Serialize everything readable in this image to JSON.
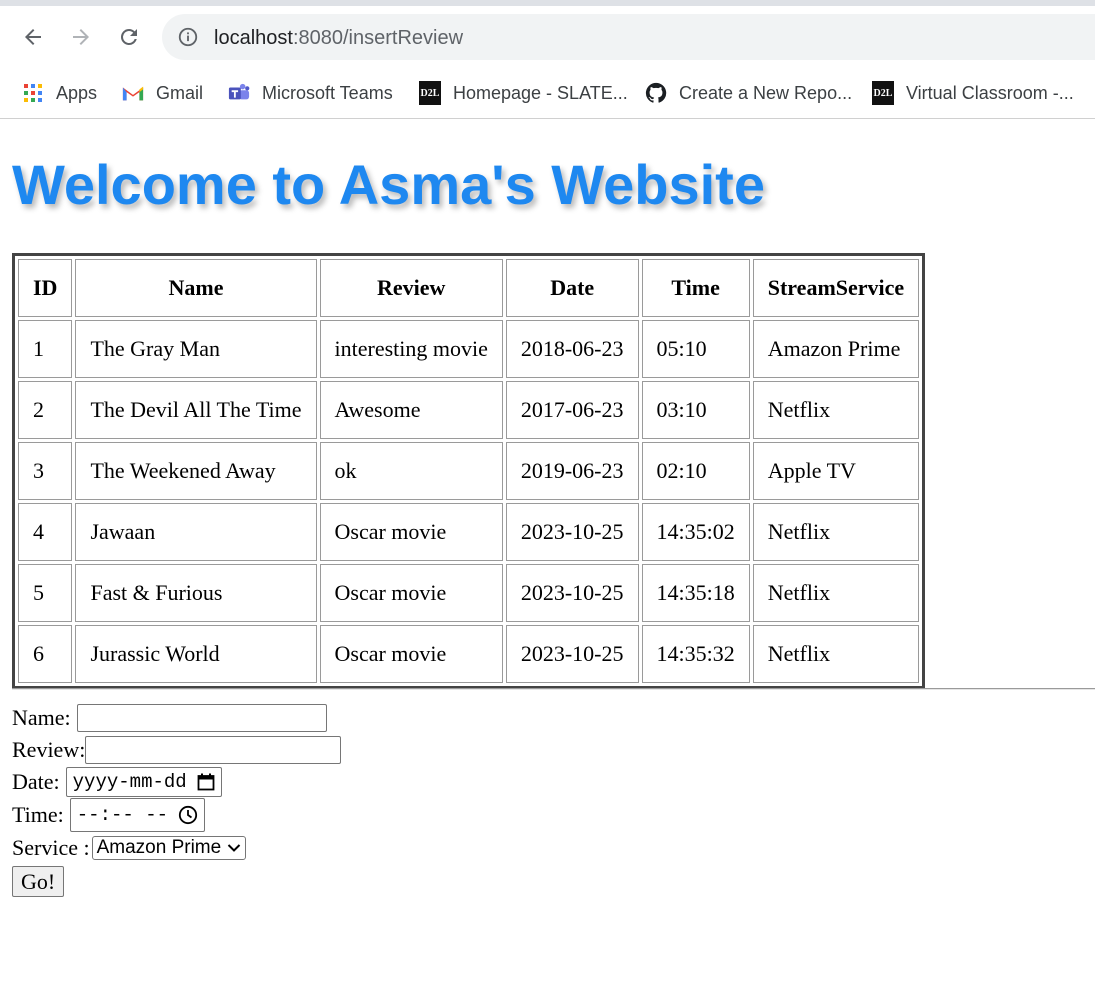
{
  "browser": {
    "url_host": "localhost",
    "url_path": ":8080/insertReview",
    "bookmarks": [
      {
        "label": "Apps",
        "icon": "apps-grid-icon"
      },
      {
        "label": "Gmail",
        "icon": "gmail-icon"
      },
      {
        "label": "Microsoft Teams",
        "icon": "teams-icon"
      },
      {
        "label": "Homepage - SLATE...",
        "icon": "d2l-icon",
        "icon_text": "D2L"
      },
      {
        "label": "Create a New Repo...",
        "icon": "github-icon"
      },
      {
        "label": "Virtual Classroom -...",
        "icon": "d2l-icon",
        "icon_text": "D2L"
      }
    ]
  },
  "page": {
    "title": "Welcome to Asma's Website",
    "title_color": "#1e88f0",
    "table": {
      "headers": [
        "ID",
        "Name",
        "Review",
        "Date",
        "Time",
        "StreamService"
      ],
      "rows": [
        [
          "1",
          "The Gray Man",
          "interesting movie",
          "2018-06-23",
          "05:10",
          "Amazon Prime"
        ],
        [
          "2",
          "The Devil All The Time",
          "Awesome",
          "2017-06-23",
          "03:10",
          "Netflix"
        ],
        [
          "3",
          "The Weekened Away",
          "ok",
          "2019-06-23",
          "02:10",
          "Apple TV"
        ],
        [
          "4",
          "Jawaan",
          "Oscar movie",
          "2023-10-25",
          "14:35:02",
          "Netflix"
        ],
        [
          "5",
          "Fast & Furious",
          "Oscar movie",
          "2023-10-25",
          "14:35:18",
          "Netflix"
        ],
        [
          "6",
          "Jurassic World",
          "Oscar movie",
          "2023-10-25",
          "14:35:32",
          "Netflix"
        ]
      ]
    },
    "form": {
      "name_label": "Name:",
      "name_value": "",
      "review_label": "Review:",
      "review_value": "",
      "date_label": "Date:",
      "date_placeholder": "yyyy-mm-dd",
      "time_label": "Time:",
      "time_placeholder": "--:-- --",
      "service_label": "Service :",
      "service_selected": "Amazon Prime",
      "submit_label": "Go!"
    }
  }
}
